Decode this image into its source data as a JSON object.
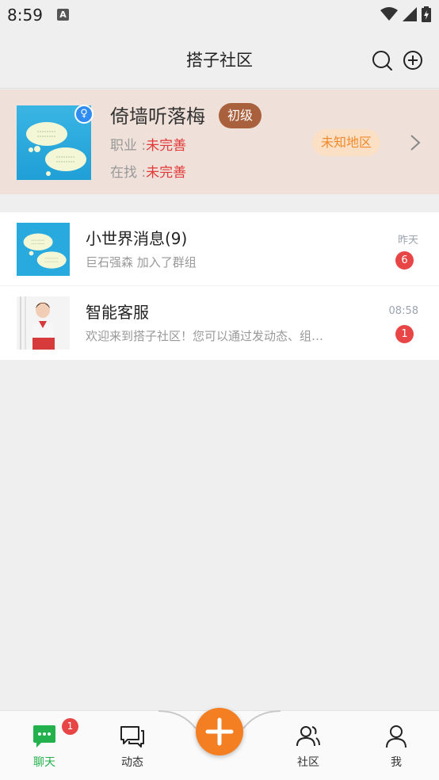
{
  "status_bar": {
    "time": "8:59",
    "notif_icon": "a-icon"
  },
  "header": {
    "title": "搭子社区",
    "search_icon": "search-icon",
    "add_icon": "add-circle-icon"
  },
  "profile": {
    "name": "倚墙听落梅",
    "gender_symbol": "♀",
    "level": "初级",
    "job_label": "职业 :",
    "job_value": "未完善",
    "seeking_label": "在找 :",
    "seeking_value": "未完善",
    "region": "未知地区"
  },
  "chats": [
    {
      "name": "小世界消息(9)",
      "message": "巨石强森 加入了群组",
      "time": "昨天",
      "unread": "6"
    },
    {
      "name": "智能客服",
      "message": "欢迎来到搭子社区！您可以通过发动态、组…",
      "time": "08:58",
      "unread": "1"
    }
  ],
  "bottom_nav": {
    "items": [
      {
        "label": "聊天",
        "icon": "chat-icon",
        "active": true,
        "badge": "1"
      },
      {
        "label": "动态",
        "icon": "feed-icon"
      },
      {
        "label": "社区",
        "icon": "community-icon"
      },
      {
        "label": "我",
        "icon": "profile-icon"
      }
    ],
    "fab_icon": "plus-icon"
  },
  "colors": {
    "accent_green": "#22b14c",
    "fab_orange": "#f47f22",
    "badge_red": "#e84646",
    "level_brown": "#a9603d"
  }
}
